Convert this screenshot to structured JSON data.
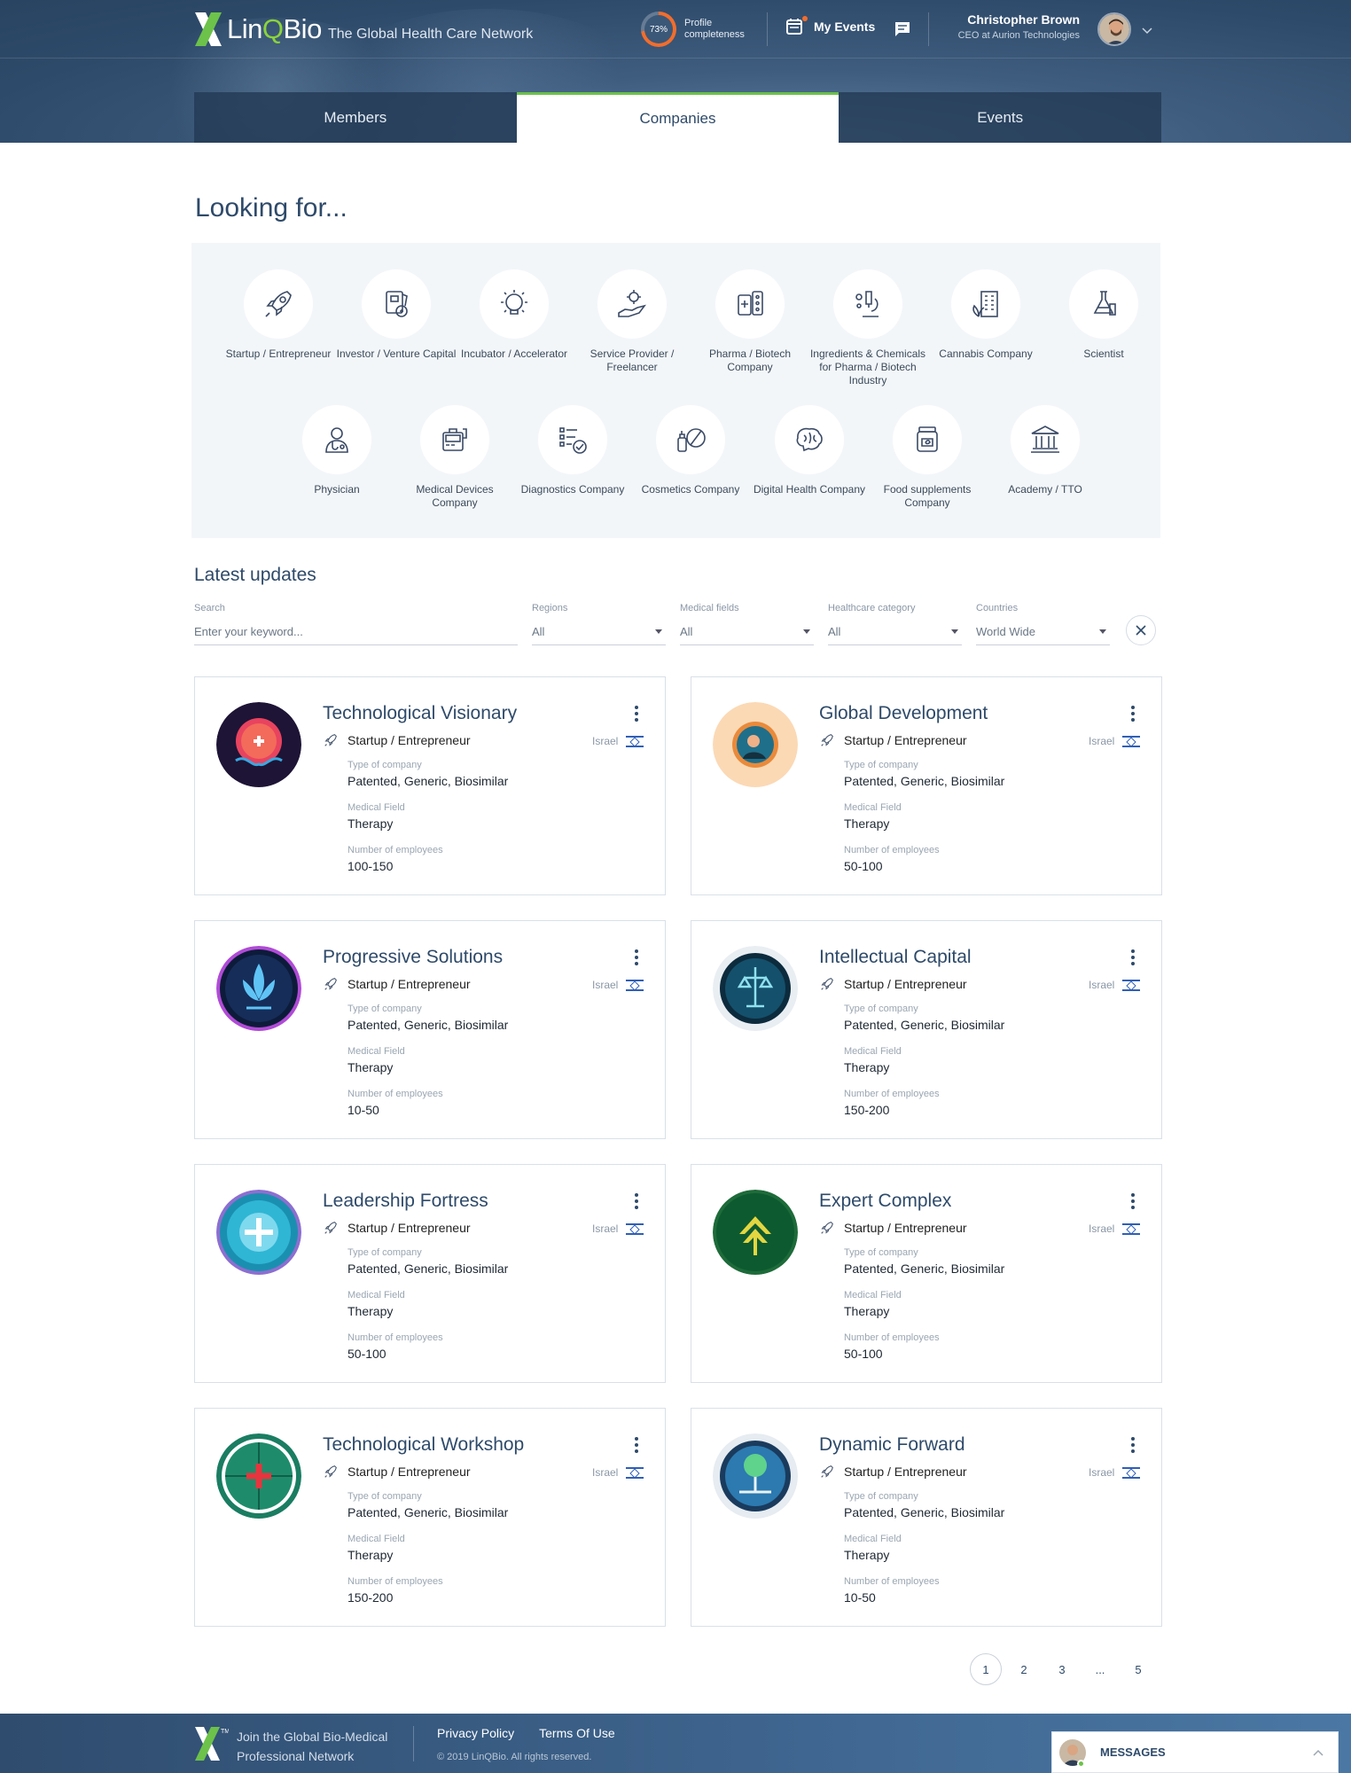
{
  "header": {
    "logo_text_1": "Lin",
    "logo_text_q": "Q",
    "logo_text_2": "Bio",
    "tagline": "The Global Health Care Network",
    "completeness_percent": "73%",
    "completeness_value": 0.73,
    "completeness_label": "Profile completeness",
    "my_events": "My Events",
    "user_name": "Christopher Brown",
    "user_role": "CEO at Aurion Technologies",
    "accent_color": "#6cc24a",
    "ring_color": "#f26d2c"
  },
  "tabs": [
    {
      "label": "Members"
    },
    {
      "label": "Companies"
    },
    {
      "label": "Events"
    }
  ],
  "looking_for": {
    "title": "Looking for...",
    "categories": [
      {
        "label": "Startup / Entrepreneur",
        "icon": "rocket-icon"
      },
      {
        "label": "Investor / Venture Capital",
        "icon": "investor-icon"
      },
      {
        "label": "Incubator / Accelerator",
        "icon": "lightbulb-icon"
      },
      {
        "label": "Service Provider / Freelancer",
        "icon": "hand-gear-icon"
      },
      {
        "label": "Pharma / Biotech Company",
        "icon": "pills-icon"
      },
      {
        "label": "Ingredients & Chemicals for Pharma / Biotech Industry",
        "icon": "microscope-icon"
      },
      {
        "label": "Cannabis Company",
        "icon": "cannabis-building-icon"
      },
      {
        "label": "Scientist",
        "icon": "flask-icon"
      },
      {
        "label": "Physician",
        "icon": "doctor-icon"
      },
      {
        "label": "Medical Devices Company",
        "icon": "medical-device-icon"
      },
      {
        "label": "Diagnostics Company",
        "icon": "checklist-icon"
      },
      {
        "label": "Cosmetics Company",
        "icon": "cosmetics-icon"
      },
      {
        "label": "Digital Health Company",
        "icon": "brain-icon"
      },
      {
        "label": "Food supplements Company",
        "icon": "jar-icon"
      },
      {
        "label": "Academy / TTO",
        "icon": "academy-icon"
      }
    ]
  },
  "latest": {
    "title": "Latest updates",
    "search_label": "Search",
    "search_placeholder": "Enter your keyword...",
    "filters": [
      {
        "label": "Regions",
        "value": "All"
      },
      {
        "label": "Medical fields",
        "value": "All"
      },
      {
        "label": "Healthcare category",
        "value": "All"
      },
      {
        "label": "Countries",
        "value": "World Wide"
      }
    ]
  },
  "card_labels": {
    "type_of_company": "Type of company",
    "medical_field": "Medical Field",
    "employees": "Number of employees"
  },
  "companies": [
    {
      "name": "Technological Visionary",
      "category": "Startup / Entrepreneur",
      "country": "Israel",
      "type": "Patented, Generic, Biosimilar",
      "field": "Therapy",
      "employees": "100-150"
    },
    {
      "name": "Global Development",
      "category": "Startup / Entrepreneur",
      "country": "Israel",
      "type": "Patented, Generic, Biosimilar",
      "field": "Therapy",
      "employees": "50-100"
    },
    {
      "name": "Progressive Solutions",
      "category": "Startup / Entrepreneur",
      "country": "Israel",
      "type": "Patented, Generic, Biosimilar",
      "field": "Therapy",
      "employees": "10-50"
    },
    {
      "name": "Intellectual Capital",
      "category": "Startup / Entrepreneur",
      "country": "Israel",
      "type": "Patented, Generic, Biosimilar",
      "field": "Therapy",
      "employees": "150-200"
    },
    {
      "name": "Leadership Fortress",
      "category": "Startup / Entrepreneur",
      "country": "Israel",
      "type": "Patented, Generic, Biosimilar",
      "field": "Therapy",
      "employees": "50-100"
    },
    {
      "name": "Expert Complex",
      "category": "Startup / Entrepreneur",
      "country": "Israel",
      "type": "Patented, Generic, Biosimilar",
      "field": "Therapy",
      "employees": "50-100"
    },
    {
      "name": "Technological Workshop",
      "category": "Startup / Entrepreneur",
      "country": "Israel",
      "type": "Patented, Generic, Biosimilar",
      "field": "Therapy",
      "employees": "150-200"
    },
    {
      "name": "Dynamic Forward",
      "category": "Startup / Entrepreneur",
      "country": "Israel",
      "type": "Patented, Generic, Biosimilar",
      "field": "Therapy",
      "employees": "10-50"
    }
  ],
  "pagination": [
    "1",
    "2",
    "3",
    "...",
    "5"
  ],
  "footer": {
    "join": "Join the Global Bio-Medical Professional Network",
    "tm": "TM",
    "privacy": "Privacy Policy",
    "terms": "Terms Of Use",
    "copyright": "© 2019 LinQBio. All rights reserved.",
    "messages": "MESSAGES"
  }
}
